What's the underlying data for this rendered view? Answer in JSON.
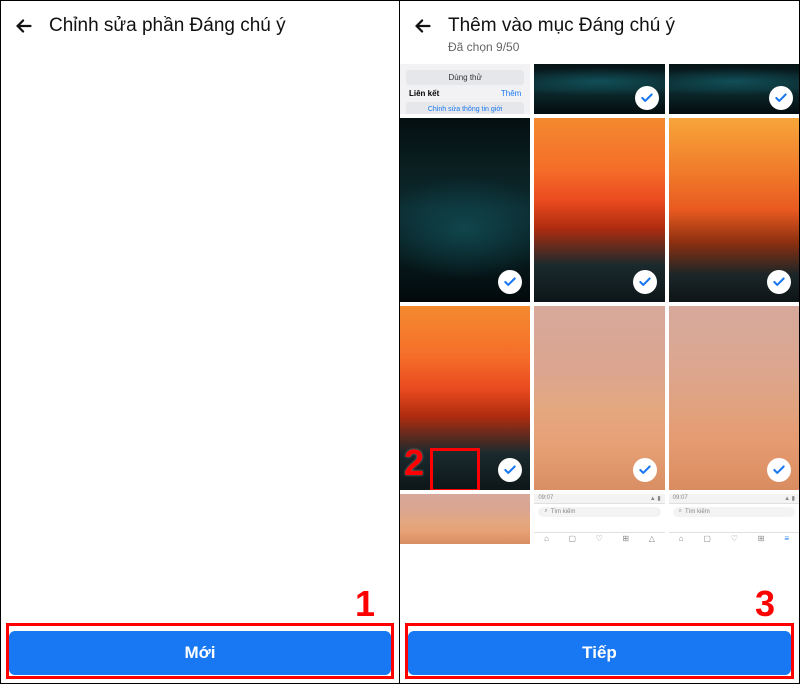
{
  "left": {
    "title": "Chỉnh sửa phần Đáng chú ý",
    "cta": "Mới"
  },
  "right": {
    "title": "Thêm vào mục Đáng chú ý",
    "subtitle": "Đã chọn 9/50",
    "cta": "Tiếp",
    "miniui": {
      "try_btn": "Dùng thử",
      "links_label": "Liên kết",
      "links_action": "Thêm",
      "bio": "Chỉnh sửa thông tin giới"
    },
    "browser": {
      "time": "09:07",
      "search": "Tìm kiếm"
    }
  },
  "annotations": {
    "n1": "1",
    "n2": "2",
    "n3": "3"
  }
}
